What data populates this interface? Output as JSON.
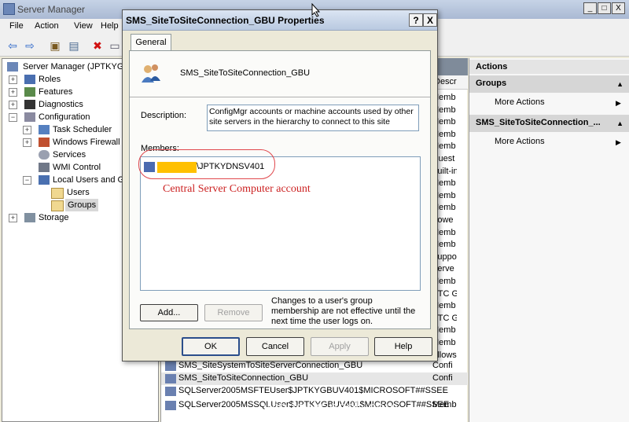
{
  "main_window": {
    "title": "Server Manager",
    "controls": [
      "_",
      "□",
      "X"
    ]
  },
  "menu": [
    "File",
    "Action",
    "View",
    "Help"
  ],
  "tree": {
    "items": [
      {
        "label": "Server Manager (JPTKYGB",
        "level": 0,
        "exp": ""
      },
      {
        "label": "Roles",
        "level": 1,
        "exp": "+"
      },
      {
        "label": "Features",
        "level": 1,
        "exp": "+"
      },
      {
        "label": "Diagnostics",
        "level": 1,
        "exp": "+"
      },
      {
        "label": "Configuration",
        "level": 1,
        "exp": "−"
      },
      {
        "label": "Task Scheduler",
        "level": 2,
        "exp": "+"
      },
      {
        "label": "Windows Firewall w",
        "level": 2,
        "exp": "+"
      },
      {
        "label": "Services",
        "level": 2,
        "exp": ""
      },
      {
        "label": "WMI Control",
        "level": 2,
        "exp": ""
      },
      {
        "label": "Local Users and Gr",
        "level": 2,
        "exp": "−"
      },
      {
        "label": "Users",
        "level": 3,
        "exp": ""
      },
      {
        "label": "Groups",
        "level": 3,
        "exp": ""
      },
      {
        "label": "Storage",
        "level": 1,
        "exp": "+"
      }
    ]
  },
  "middle": {
    "col_desc": "Descr",
    "desc_fragments": [
      "Memb",
      "Memb",
      "Memb",
      "Memb",
      "Memb",
      "Guest",
      "Built-in",
      "Memb",
      "Memb",
      "Memb",
      "Powe",
      "Memb",
      "Memb",
      "Suppo",
      "Serve",
      "Memb",
      "RTC G",
      "Memb",
      "RTC G",
      "Memb",
      "Memb",
      "Allows"
    ],
    "rows": [
      {
        "name": "SMS_SiteSystemToSiteServerConnection_GBU",
        "desc": "Confi"
      },
      {
        "name": "SMS_SiteToSiteConnection_GBU",
        "desc": "Confi"
      },
      {
        "name": "SQLServer2005MSFTEUser$JPTKYGBUV401$MICROSOFT##SSEE",
        "desc": ""
      },
      {
        "name": "SQLServer2005MSSQLUser$JPTKYGBUV401$MICROSOFT##SSEE",
        "desc": "Memb"
      }
    ]
  },
  "actions": {
    "title": "Actions",
    "sections": [
      {
        "header": "Groups",
        "item": "More Actions"
      },
      {
        "header": "SMS_SiteToSiteConnection_...",
        "item": "More Actions"
      }
    ]
  },
  "dialog": {
    "title": "SMS_SiteToSiteConnection_GBU Properties",
    "help_btn": "?",
    "close_btn": "X",
    "tab": "General",
    "group_name": "SMS_SiteToSiteConnection_GBU",
    "description_label": "Description:",
    "description_value": "ConfigMgr accounts or machine accounts used by other site servers in the hierarchy to connect to this site",
    "members_label": "Members:",
    "member": "\\JPTKYDNSV401",
    "add_btn": "Add...",
    "remove_btn": "Remove",
    "note": "Changes to a user's group membership are not effective until the next time the user logs on.",
    "ok_btn": "OK",
    "cancel_btn": "Cancel",
    "apply_btn": "Apply",
    "help2_btn": "Help"
  },
  "annotation": "Central Server Computer account",
  "watermark": "windows-noob.com",
  "colors": {
    "highlight": "#ffc000",
    "annotation": "#cc2222"
  }
}
